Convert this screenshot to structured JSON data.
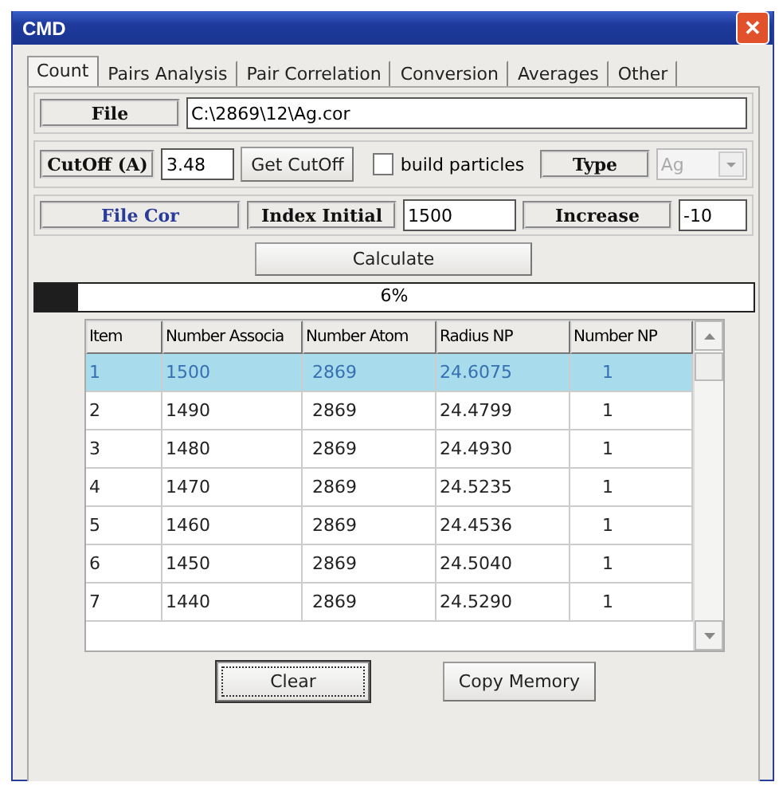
{
  "window": {
    "title": "CMD",
    "close_label": "✕"
  },
  "tabs": [
    {
      "label": "Count",
      "selected": true
    },
    {
      "label": "Pairs Analysis",
      "selected": false
    },
    {
      "label": "Pair Correlation",
      "selected": false
    },
    {
      "label": "Conversion",
      "selected": false
    },
    {
      "label": "Averages",
      "selected": false
    },
    {
      "label": "Other",
      "selected": false
    }
  ],
  "file": {
    "label": "File",
    "value": "C:\\2869\\12\\Ag.cor"
  },
  "cutoff": {
    "label": "CutOff (A)",
    "value": "3.48",
    "button": "Get CutOff",
    "build_particles": {
      "label": "build particles",
      "checked": false
    },
    "type_label": "Type",
    "type": {
      "value": "Ag",
      "disabled": true
    }
  },
  "index_row": {
    "file_cor": "File Cor",
    "index_label": "Index Initial",
    "index_value": "1500",
    "increase_label": "Increase",
    "increase_value": "-10"
  },
  "calculate": "Calculate",
  "progress": {
    "level": 0.06,
    "reading": "6%"
  },
  "table": {
    "columns": [
      "Item",
      "Number Associa",
      "Number Atom",
      "Radius NP",
      "Number NP"
    ],
    "rows": [
      {
        "cells": [
          "1",
          "1500",
          "2869",
          "24.6075",
          "1"
        ],
        "selected": true
      },
      {
        "cells": [
          "2",
          "1490",
          "2869",
          "24.4799",
          "1"
        ],
        "selected": false
      },
      {
        "cells": [
          "3",
          "1480",
          "2869",
          "24.4930",
          "1"
        ],
        "selected": false
      },
      {
        "cells": [
          "4",
          "1470",
          "2869",
          "24.5235",
          "1"
        ],
        "selected": false
      },
      {
        "cells": [
          "5",
          "1460",
          "2869",
          "24.4536",
          "1"
        ],
        "selected": false
      },
      {
        "cells": [
          "6",
          "1450",
          "2869",
          "24.5040",
          "1"
        ],
        "selected": false
      },
      {
        "cells": [
          "7",
          "1440",
          "2869",
          "24.5290",
          "1"
        ],
        "selected": false
      }
    ]
  },
  "buttons": [
    {
      "label": "Clear",
      "focused": true
    },
    {
      "label": "Copy Memory",
      "focused": false
    }
  ]
}
